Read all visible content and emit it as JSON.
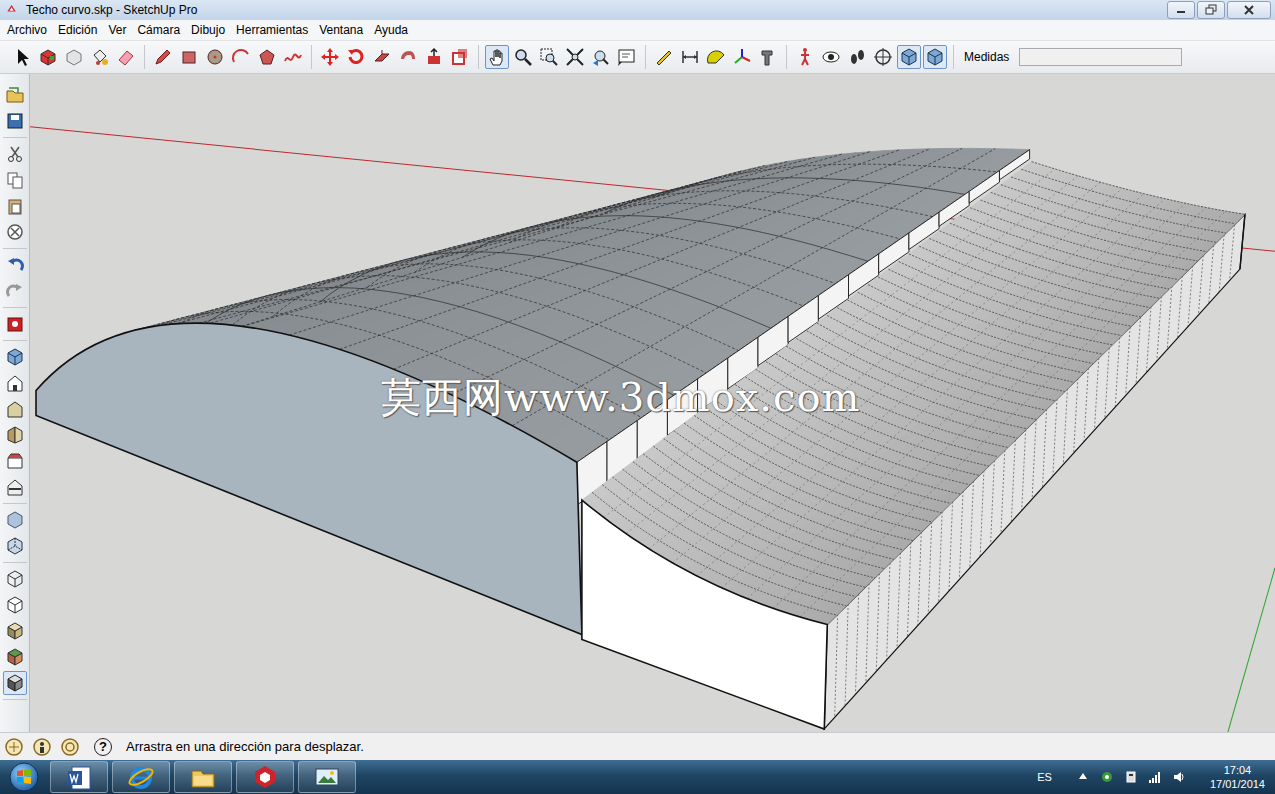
{
  "window": {
    "title": "Techo curvo.skp - SketchUp Pro"
  },
  "menu": [
    "Archivo",
    "Edición",
    "Ver",
    "Cámara",
    "Dibujo",
    "Herramientas",
    "Ventana",
    "Ayuda"
  ],
  "toolbar": {
    "tools": [
      {
        "selected": false
      },
      {
        "selected": false
      },
      {
        "selected": false
      },
      {
        "selected": false
      },
      {
        "selected": false
      },
      {
        "selected": false
      },
      {
        "selected": false
      },
      {
        "selected": false
      },
      {
        "selected": false
      },
      {
        "selected": false
      },
      {
        "selected": false
      },
      {
        "selected": false
      },
      {
        "selected": false
      },
      {
        "selected": false
      },
      {
        "selected": false
      },
      {
        "selected": false
      },
      {
        "selected": false
      },
      {
        "selected": true
      },
      {
        "selected": false
      },
      {
        "selected": false
      },
      {
        "selected": false
      },
      {
        "selected": false
      },
      {
        "selected": false
      },
      {
        "selected": false
      },
      {
        "selected": false
      },
      {
        "selected": false
      },
      {
        "selected": false
      },
      {
        "selected": false
      },
      {
        "selected": false
      },
      {
        "selected": false
      },
      {
        "selected": false
      },
      {
        "selected": false
      },
      {
        "selected": true
      },
      {
        "selected": true
      }
    ]
  },
  "measurements": {
    "label": "Medidas",
    "value": ""
  },
  "side_toolbar": {
    "tools": [
      {
        "selected": false
      },
      {
        "selected": false
      },
      {
        "selected": false
      },
      {
        "selected": false
      },
      {
        "selected": false
      },
      {
        "selected": false
      },
      {
        "selected": false
      },
      {
        "selected": false
      },
      {
        "selected": false
      },
      {
        "selected": false
      },
      {
        "selected": false
      },
      {
        "selected": false
      },
      {
        "selected": false
      },
      {
        "selected": false
      },
      {
        "selected": false
      },
      {
        "selected": false
      },
      {
        "selected": false
      },
      {
        "selected": false
      },
      {
        "selected": false
      },
      {
        "selected": false
      },
      {
        "selected": false
      },
      {
        "selected": true
      }
    ]
  },
  "viewport": {
    "watermark": "莫西网www.3dmox.com"
  },
  "status_bar": {
    "help": "?",
    "message": "Arrastra en una dirección para desplazar."
  },
  "taskbar": {
    "language": "ES",
    "time": "17:04",
    "date": "17/01/2014"
  }
}
